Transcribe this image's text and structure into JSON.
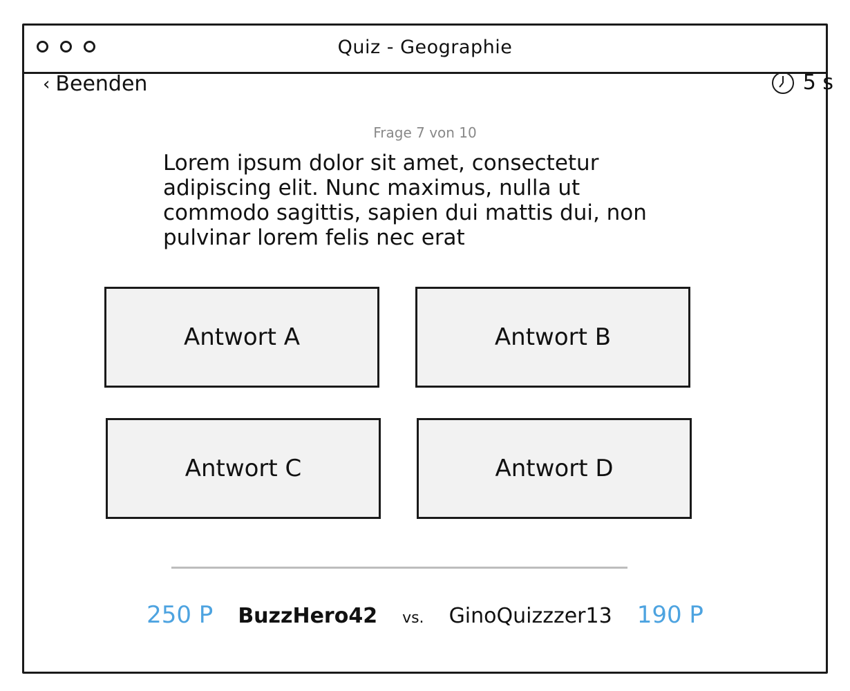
{
  "window": {
    "title": "Quiz - Geographie"
  },
  "nav": {
    "back_label": "Beenden",
    "back_icon": "chevron-left-icon"
  },
  "timer": {
    "icon": "clock-icon",
    "value": "5 s"
  },
  "question": {
    "counter": "Frage 7 von 10",
    "text": "Lorem ipsum dolor sit amet, consectetur adipiscing elit. Nunc maximus, nulla ut commodo sagittis, sapien dui mattis dui, non pulvinar lorem felis nec erat"
  },
  "answers": [
    {
      "label": "Antwort A"
    },
    {
      "label": "Antwort B"
    },
    {
      "label": "Antwort C"
    },
    {
      "label": "Antwort D"
    }
  ],
  "progress": {
    "fraction": 1.0
  },
  "scoreboard": {
    "player1_score": "250 P",
    "player1_name": "BuzzHero42",
    "vs": "vs.",
    "player2_name": "GinoQuizzzer13",
    "player2_score": "190 P",
    "score_color": "#4da3e0"
  }
}
